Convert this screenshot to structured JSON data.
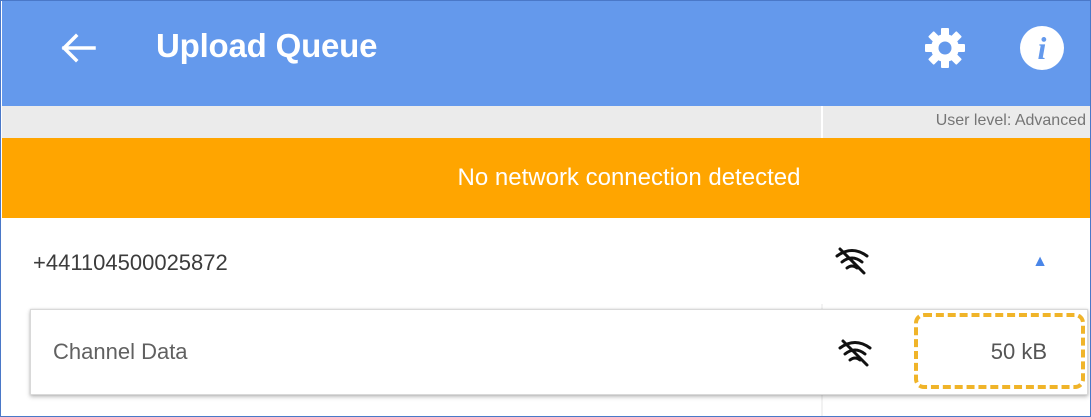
{
  "header": {
    "title": "Upload Queue",
    "back_icon": "arrow-left-icon",
    "settings_icon": "gear-icon",
    "info_icon": "info-icon",
    "info_glyph": "i",
    "background": "#6499ec"
  },
  "user_level": {
    "text": "User level: Advanced"
  },
  "banner": {
    "text": "No network connection detected",
    "background": "#ffa500"
  },
  "queue": {
    "group": {
      "id": "+441104500025872",
      "status_icon": "no-wifi-icon",
      "toggle_icon": "triangle-up-icon",
      "toggle_glyph": "▲"
    },
    "items": [
      {
        "label": "Channel Data",
        "status_icon": "no-wifi-icon",
        "size": "50 kB"
      }
    ]
  },
  "colors": {
    "accent": "#4a86e8",
    "highlight_dashed": "#f0b429"
  }
}
